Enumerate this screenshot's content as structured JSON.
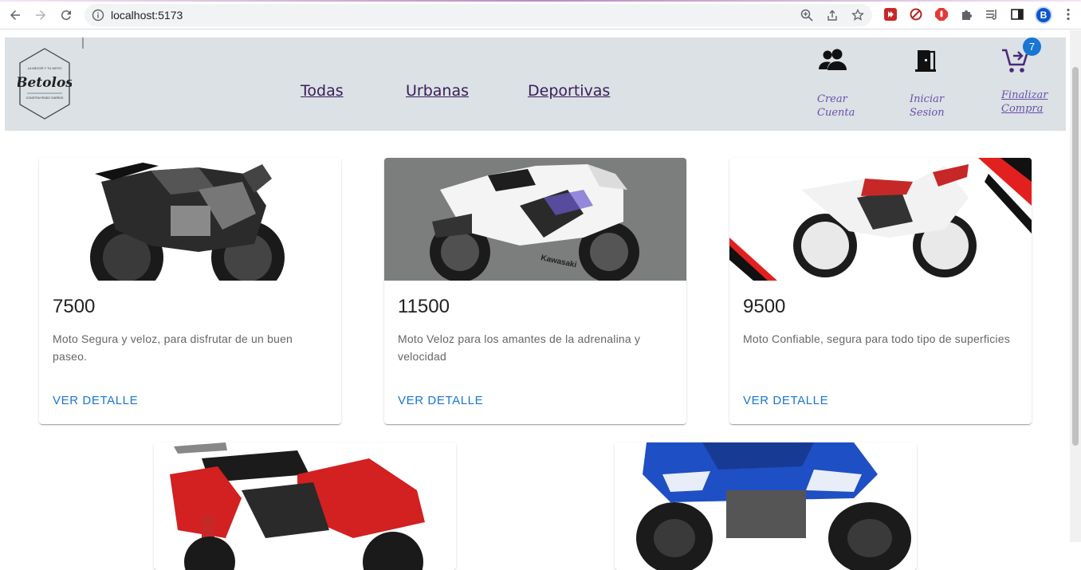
{
  "browser": {
    "url": "localhost:5173",
    "profile_initial": "B"
  },
  "site": {
    "logo": {
      "top_text": "LA MEJOR Y TU MOTO",
      "name": "Betolos",
      "bottom_text": "CONSTRUYENDO SUEÑOS"
    },
    "nav": [
      "Todas",
      "Urbanas",
      "Deportivas"
    ],
    "actions": {
      "create_account": [
        "Crear",
        "Cuenta"
      ],
      "login": [
        "Iniciar",
        "Sesion"
      ],
      "checkout": [
        "Finalizar",
        "Compra"
      ]
    },
    "cart_count": "7"
  },
  "products": [
    {
      "price": "7500",
      "description": "Moto Segura y veloz, para disfrutar de un buen paseo.",
      "button": "VER DETALLE",
      "image": "naked-black-motorcycle"
    },
    {
      "price": "11500",
      "description": "Moto Veloz para los amantes de la adrenalina y velocidad",
      "button": "VER DETALLE",
      "image": "white-sport-motorcycle"
    },
    {
      "price": "9500",
      "description": "Moto Confiable, segura para todo tipo de superficies",
      "button": "VER DETALLE",
      "image": "dirt-bike-motorcycle"
    },
    {
      "image": "red-scooter-motorcycle"
    },
    {
      "image": "blue-quad-atv"
    }
  ],
  "colors": {
    "header_bg": "#dbe1e4",
    "nav_text": "#3a1c5a",
    "action_text": "#6b4fae",
    "button_blue": "#1976d2",
    "badge_blue": "#1976d2"
  }
}
